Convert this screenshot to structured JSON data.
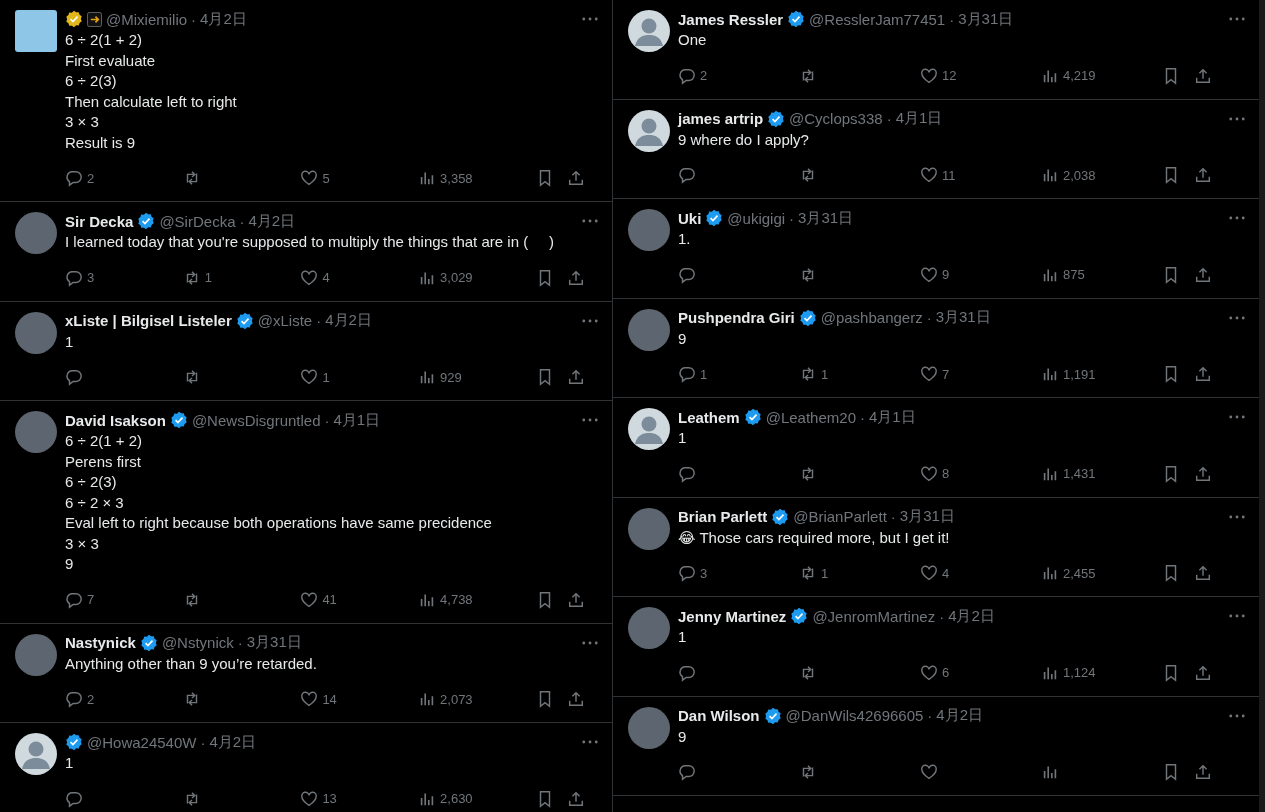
{
  "columns": [
    {
      "tweets": [
        {
          "photo_avatar": true,
          "square_avatar": true,
          "verified": true,
          "gold_check": true,
          "extra_badge": true,
          "handle": "@Mixiemilio",
          "separator": "·",
          "date": "4月2日",
          "lines": [
            "6 ÷ 2(1 + 2)",
            "First evaluate",
            "6 ÷ 2(3)",
            "Then calculate left to right",
            "3 × 3",
            "Result is 9"
          ],
          "replies": "2",
          "likes": "5",
          "views": "3,358"
        },
        {
          "photo_avatar": true,
          "name": "Sir Decka",
          "verified": true,
          "handle": "@SirDecka",
          "separator": "·",
          "date": "4月2日",
          "lines": [
            "I learned today that you're supposed to multiply the things that are in (     )"
          ],
          "replies": "3",
          "retweets": "1",
          "likes": "4",
          "views": "3,029"
        },
        {
          "photo_avatar": true,
          "name": "xListe | Bilgisel Listeler",
          "verified": true,
          "handle": "@xListe",
          "separator": "·",
          "date": "4月2日",
          "lines": [
            "1"
          ],
          "likes": "1",
          "views": "929"
        },
        {
          "photo_avatar": true,
          "name": "David Isakson",
          "verified": true,
          "handle": "@NewsDisgruntled",
          "separator": "·",
          "date": "4月1日",
          "lines": [
            "6 ÷ 2(1 + 2)",
            "Perens first",
            "6 ÷ 2(3)",
            "6 ÷ 2 × 3",
            "Eval left to right because both operations have same precidence",
            "3 × 3",
            "9"
          ],
          "replies": "7",
          "likes": "41",
          "views": "4,738"
        },
        {
          "photo_avatar": true,
          "name": "Nastynick",
          "verified": true,
          "handle": "@Nstynick",
          "separator": "·",
          "date": "3月31日",
          "lines": [
            "Anything other than 9 you’re retarded."
          ],
          "replies": "2",
          "likes": "14",
          "views": "2,073"
        },
        {
          "photo_avatar": false,
          "verified": true,
          "handle": "@Howa24540W",
          "separator": "·",
          "date": "4月2日",
          "lines": [
            "1"
          ],
          "likes": "13",
          "views": "2,630"
        }
      ]
    },
    {
      "tweets": [
        {
          "photo_avatar": false,
          "name": "James Ressler",
          "verified": true,
          "handle": "@ResslerJam77451",
          "separator": "·",
          "date": "3月31日",
          "lines": [
            "One"
          ],
          "replies": "2",
          "likes": "12",
          "views": "4,219"
        },
        {
          "photo_avatar": false,
          "name": "james artrip",
          "verified": true,
          "handle": "@Cyclops338",
          "separator": "·",
          "date": "4月1日",
          "lines": [
            "9 where do I apply?"
          ],
          "likes": "11",
          "views": "2,038"
        },
        {
          "photo_avatar": true,
          "name": "Uki",
          "verified": true,
          "handle": "@ukigigi",
          "separator": "·",
          "date": "3月31日",
          "lines": [
            "1."
          ],
          "likes": "9",
          "views": "875"
        },
        {
          "photo_avatar": true,
          "name": "Pushpendra Giri",
          "verified": true,
          "handle": "@pashbangerz",
          "separator": "·",
          "date": "3月31日",
          "lines": [
            "9"
          ],
          "replies": "1",
          "retweets": "1",
          "likes": "7",
          "views": "1,191"
        },
        {
          "photo_avatar": false,
          "name": "Leathem",
          "verified": true,
          "handle": "@Leathem20",
          "separator": "·",
          "date": "4月1日",
          "lines": [
            "1"
          ],
          "likes": "8",
          "views": "1,431"
        },
        {
          "photo_avatar": true,
          "name": "Brian Parlett",
          "verified": true,
          "handle": "@BrianParlett",
          "separator": "·",
          "date": "3月31日",
          "lines": [
            "😂 Those cars required more, but I get it!"
          ],
          "replies": "3",
          "retweets": "1",
          "likes": "4",
          "views": "2,455"
        },
        {
          "photo_avatar": true,
          "name": "Jenny Martinez",
          "verified": true,
          "handle": "@JenromMartinez",
          "separator": "·",
          "date": "4月2日",
          "lines": [
            "1"
          ],
          "likes": "6",
          "views": "1,124"
        },
        {
          "photo_avatar": true,
          "name": "Dan Wilson",
          "verified": true,
          "handle": "@DanWils42696605",
          "separator": "·",
          "date": "4月2日",
          "lines": [
            "9"
          ]
        }
      ]
    }
  ]
}
